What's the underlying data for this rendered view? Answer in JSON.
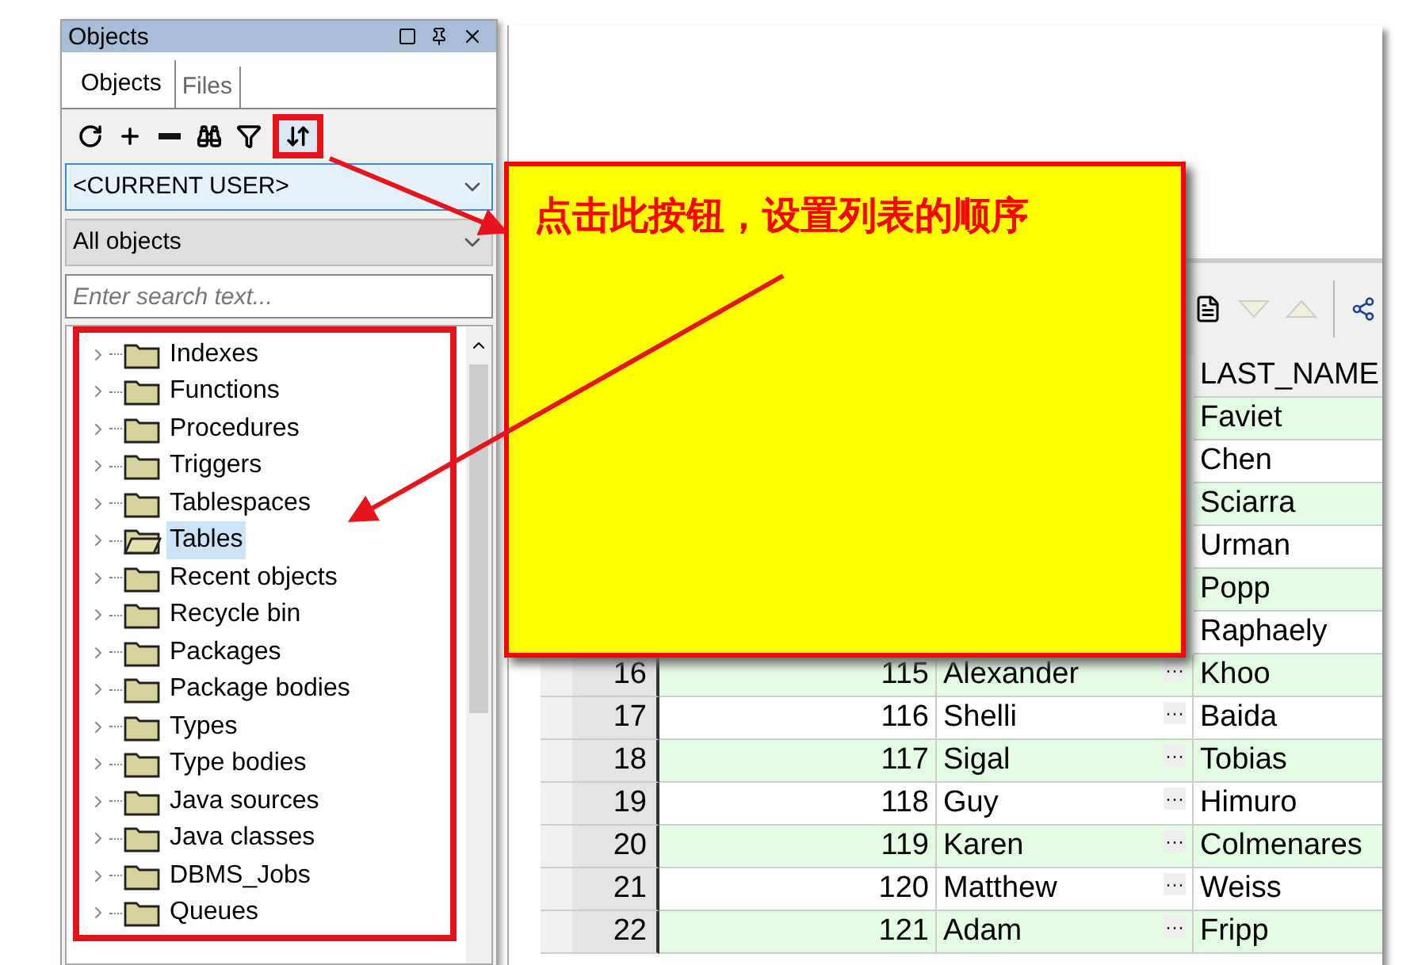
{
  "panel": {
    "title": "Objects"
  },
  "tabs": [
    {
      "label": "Objects",
      "selected": true
    },
    {
      "label": "Files",
      "selected": false
    }
  ],
  "toolbar": [
    {
      "kind": "refresh",
      "highlighted": false
    },
    {
      "kind": "add",
      "highlighted": false
    },
    {
      "kind": "remove",
      "highlighted": false
    },
    {
      "kind": "find",
      "highlighted": false
    },
    {
      "kind": "filter",
      "highlighted": false
    },
    {
      "kind": "sort",
      "highlighted": true
    }
  ],
  "user_select": {
    "value": "<CURRENT USER>"
  },
  "type_select": {
    "value": "All objects"
  },
  "search": {
    "placeholder": "Enter search text..."
  },
  "tree": [
    {
      "label": "Indexes",
      "selected": false
    },
    {
      "label": "Functions",
      "selected": false
    },
    {
      "label": "Procedures",
      "selected": false
    },
    {
      "label": "Triggers",
      "selected": false
    },
    {
      "label": "Tablespaces",
      "selected": false
    },
    {
      "label": "Tables",
      "selected": true
    },
    {
      "label": "Recent objects",
      "selected": false
    },
    {
      "label": "Recycle bin",
      "selected": false
    },
    {
      "label": "Packages",
      "selected": false
    },
    {
      "label": "Package bodies",
      "selected": false
    },
    {
      "label": "Types",
      "selected": false
    },
    {
      "label": "Type bodies",
      "selected": false
    },
    {
      "label": "Java sources",
      "selected": false
    },
    {
      "label": "Java classes",
      "selected": false
    },
    {
      "label": "DBMS_Jobs",
      "selected": false
    },
    {
      "label": "Queues",
      "selected": false
    }
  ],
  "callout": {
    "text": "点击此按钮，设置列表的顺序"
  },
  "grid": {
    "columns": [
      "LAST_NAME"
    ],
    "rows": [
      {
        "last_name": "Faviet"
      },
      {
        "last_name": "Chen"
      },
      {
        "last_name": "Sciarra"
      },
      {
        "last_name": "Urman"
      },
      {
        "last_name": "Popp"
      },
      {
        "last_name": "Raphaely"
      },
      {
        "row": "16",
        "id": "115",
        "first_name": "Alexander",
        "ellipsis": "···",
        "last_name": "Khoo"
      },
      {
        "row": "17",
        "id": "116",
        "first_name": "Shelli",
        "ellipsis": "···",
        "last_name": "Baida"
      },
      {
        "row": "18",
        "id": "117",
        "first_name": "Sigal",
        "ellipsis": "···",
        "last_name": "Tobias"
      },
      {
        "row": "19",
        "id": "118",
        "first_name": "Guy",
        "ellipsis": "···",
        "last_name": "Himuro"
      },
      {
        "row": "20",
        "id": "119",
        "first_name": "Karen",
        "ellipsis": "···",
        "last_name": "Colmenares"
      },
      {
        "row": "21",
        "id": "120",
        "first_name": "Matthew",
        "ellipsis": "···",
        "last_name": "Weiss"
      },
      {
        "row": "22",
        "id": "121",
        "first_name": "Adam",
        "ellipsis": "···",
        "last_name": "Fripp"
      }
    ]
  }
}
